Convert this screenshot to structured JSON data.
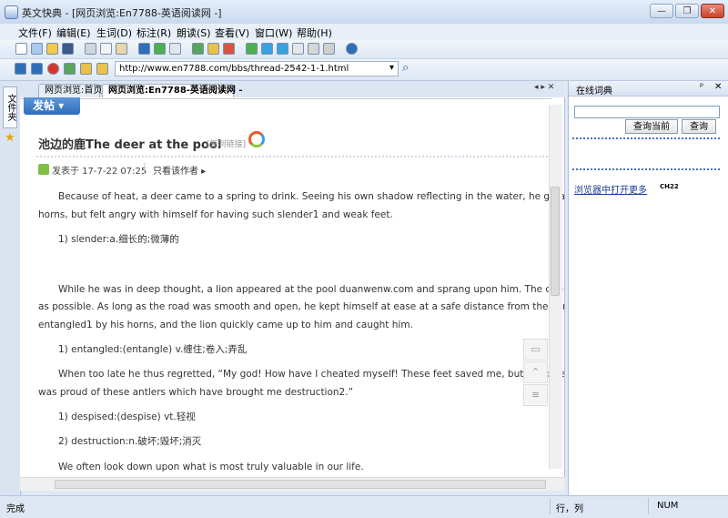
{
  "window": {
    "title": "英文快典 - [网页浏览:En7788-英语阅读网 -]",
    "minimize_glyph": "—",
    "restore_glyph": "❐",
    "close_glyph": "✕"
  },
  "menu": [
    "文件(F)",
    "编辑(E)",
    "生词(D)",
    "标注(R)",
    "朗读(S)",
    "查看(V)",
    "窗口(W)",
    "帮助(H)"
  ],
  "address": {
    "url": "http://www.en7788.com/bbs/thread-2542-1-1.html",
    "dropdown_glyph": "▾",
    "search_glyph": "⌕"
  },
  "side_tab": {
    "label": "文件夹",
    "star": "★"
  },
  "tabs": [
    {
      "label": "网页浏览:首页"
    },
    {
      "label": "网页浏览:En7788-英语阅读网 -"
    }
  ],
  "tab_nav": "◂ ▸ ✕",
  "post": {
    "post_button": "发帖 ▾",
    "title": "池边的鹿The deer at the pool",
    "copy_link": "[复制链接]",
    "meta": "发表于 17-7-22 07:25",
    "only_author": "只看该作者 ▸",
    "paragraphs": [
      "Because of heat, a deer came to a spring to drink. Seeing his own shadow reflecting in the water, he greatly admir",
      "horns, but felt angry with himself for having such slender1 and weak feet.",
      "1) slender:a.细长的;微薄的",
      "While he was in deep thought, a lion appeared at the pool duanwenw.com and sprang upon him. The deer immed",
      "as possible. As long as the road was smooth and open, he kept himself at ease at a safe distance from the lion. But ent",
      "entangled1 by his horns, and the lion quickly came up to him and caught him.",
      "1) entangled:(entangle) v.缠住;卷入;弄乱",
      "When too late he thus regretted, “My god! How have I cheated myself! These feet saved me, but I had des",
      "was proud of these antlers which have brought me destruction2.”",
      "1) despised:(despise) vt.轻视",
      "2) destruction:n.破坏;毁坏;消灭",
      "We often look down upon what is most truly valuable in our life."
    ]
  },
  "float_tools": [
    "comment-icon",
    "to-top-icon",
    "list-icon"
  ],
  "dict": {
    "title": "在线词典",
    "pin": "ᵖ",
    "close": "✕",
    "btn_query_current": "查询当前",
    "btn_query": "查询",
    "open_in_browser": "浏览器中打开",
    "more": "更多",
    "flag_text": "CH22"
  },
  "status": {
    "text": "完成",
    "position": "行，列",
    "num": "NUM"
  }
}
